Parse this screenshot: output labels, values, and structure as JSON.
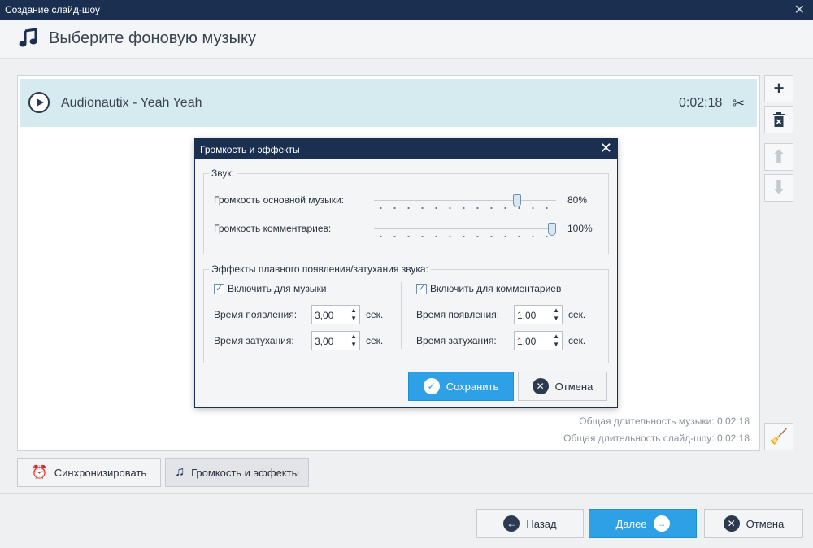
{
  "window": {
    "title": "Создание слайд-шоу",
    "close": "✕"
  },
  "header": {
    "title": "Выберите фоновую музыку"
  },
  "track": {
    "name": "Audionautix - Yeah Yeah",
    "duration": "0:02:18"
  },
  "totals": {
    "music": "Общая длительность музыки: 0:02:18",
    "slideshow": "Общая длительность слайд-шоу: 0:02:18"
  },
  "toolbar": {
    "sync_label": "Синхронизировать",
    "volume_label": "Громкость и эффекты"
  },
  "nav": {
    "back": "Назад",
    "next": "Далее",
    "cancel": "Отмена"
  },
  "dialog": {
    "title": "Громкость и эффекты",
    "sound_group": "Звук:",
    "main_volume_label": "Громкость основной музыки:",
    "main_volume_value": "80%",
    "main_volume_level": 0.8,
    "comment_volume_label": "Громкость комментариев:",
    "comment_volume_value": "100%",
    "comment_volume_level": 1.0,
    "fade_group": "Эффекты плавного появления/затухания звука:",
    "music": {
      "enable_label": "Включить для музыки",
      "enabled": true,
      "fadein_label": "Время появления:",
      "fadein_value": "3,00",
      "fadeout_label": "Время затухания:",
      "fadeout_value": "3,00",
      "unit": "сек."
    },
    "comments": {
      "enable_label": "Включить для комментариев",
      "enabled": true,
      "fadein_label": "Время появления:",
      "fadein_value": "1,00",
      "fadeout_label": "Время затухания:",
      "fadeout_value": "1,00",
      "unit": "сек."
    },
    "save": "Сохранить",
    "cancel": "Отмена"
  },
  "icons": {
    "accent": "#2ea0e6",
    "titlebar": "#1b3050",
    "track_highlight": "#d6ebf0"
  }
}
